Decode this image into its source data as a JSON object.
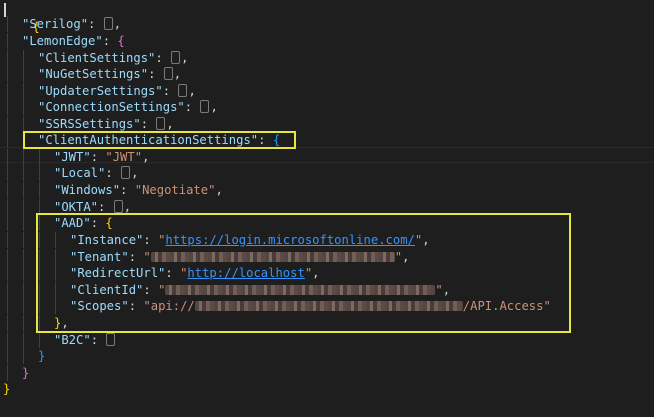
{
  "code": {
    "open_brace": "{",
    "close_brace": "}",
    "serilog_key": "\"Serilog\"",
    "lemonedge_key": "\"LemonEdge\"",
    "client_settings_key": "\"ClientSettings\"",
    "nuget_settings_key": "\"NuGetSettings\"",
    "updater_settings_key": "\"UpdaterSettings\"",
    "connection_settings_key": "\"ConnectionSettings\"",
    "ssrs_settings_key": "\"SSRSSettings\"",
    "client_auth_key": "\"ClientAuthenticationSettings\"",
    "jwt_key": "\"JWT\"",
    "jwt_value": "\"JWT\"",
    "local_key": "\"Local\"",
    "windows_key": "\"Windows\"",
    "windows_value": "\"Negotiate\"",
    "okta_key": "\"OKTA\"",
    "aad_key": "\"AAD\"",
    "instance_key": "\"Instance\"",
    "instance_url": "https://login.microsoftonline.com/",
    "tenant_key": "\"Tenant\"",
    "redirect_key": "\"RedirectUrl\"",
    "redirect_url": "http://localhost",
    "clientid_key": "\"ClientId\"",
    "scopes_key": "\"Scopes\"",
    "scopes_prefix": "api://",
    "scopes_suffix": "/API.Access",
    "b2c_key": "\"B2C\""
  },
  "colors": {
    "background": "#1e1e1e",
    "key": "#9cdcfe",
    "string": "#ce9178",
    "link": "#3794ff",
    "highlight_box": "#e6e641",
    "bracket_level1": "#ffd700",
    "bracket_level2": "#da70d6",
    "bracket_level3": "#179fff"
  }
}
